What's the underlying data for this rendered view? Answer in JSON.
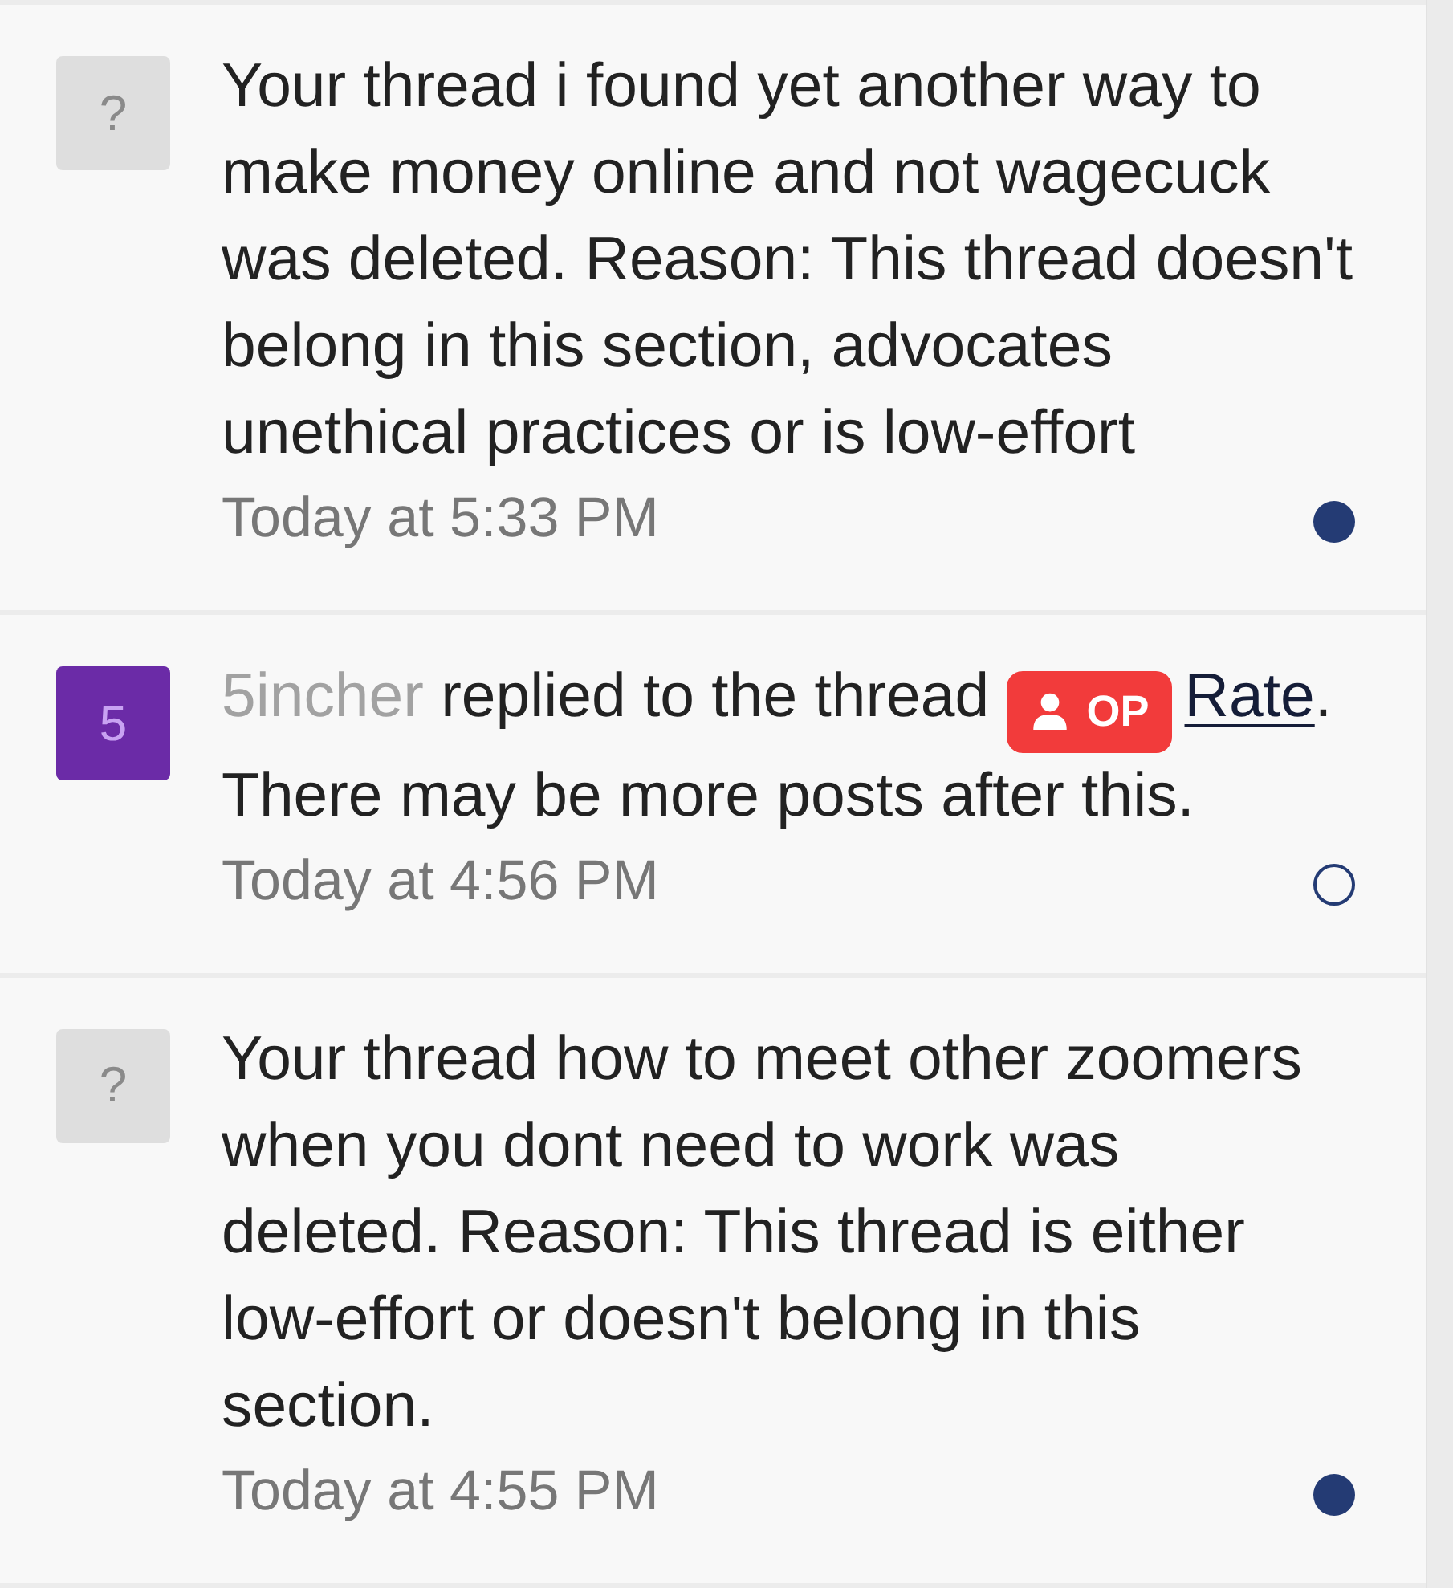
{
  "notifications": [
    {
      "avatar": {
        "kind": "unknown",
        "text": "?",
        "color": "#dedede"
      },
      "message": [
        {
          "kind": "text",
          "text": "Your thread i found yet another way to make money online and not wagecuck was deleted. Reason: This thread doesn't belong in this section, advocates unethical practices or is low-effort"
        }
      ],
      "time": "Today at 5:33 PM",
      "unread": true
    },
    {
      "avatar": {
        "kind": "user",
        "text": "5",
        "color": "#6b2ba7"
      },
      "message": [
        {
          "kind": "user",
          "text": "5incher"
        },
        {
          "kind": "text",
          "text": " replied to the thread "
        },
        {
          "kind": "badge",
          "text": "OP"
        },
        {
          "kind": "link",
          "text": "Rate"
        },
        {
          "kind": "text",
          "text": ". "
        },
        {
          "kind": "text",
          "text": "There may be more posts after this."
        }
      ],
      "time": "Today at 4:56 PM",
      "unread": false
    },
    {
      "avatar": {
        "kind": "unknown",
        "text": "?",
        "color": "#dedede"
      },
      "message": [
        {
          "kind": "text",
          "text": "Your thread how to meet other zoomers when you dont need to work was deleted. Reason: This thread is either low-effort or doesn't belong in this section."
        }
      ],
      "time": "Today at 4:55 PM",
      "unread": true
    }
  ]
}
